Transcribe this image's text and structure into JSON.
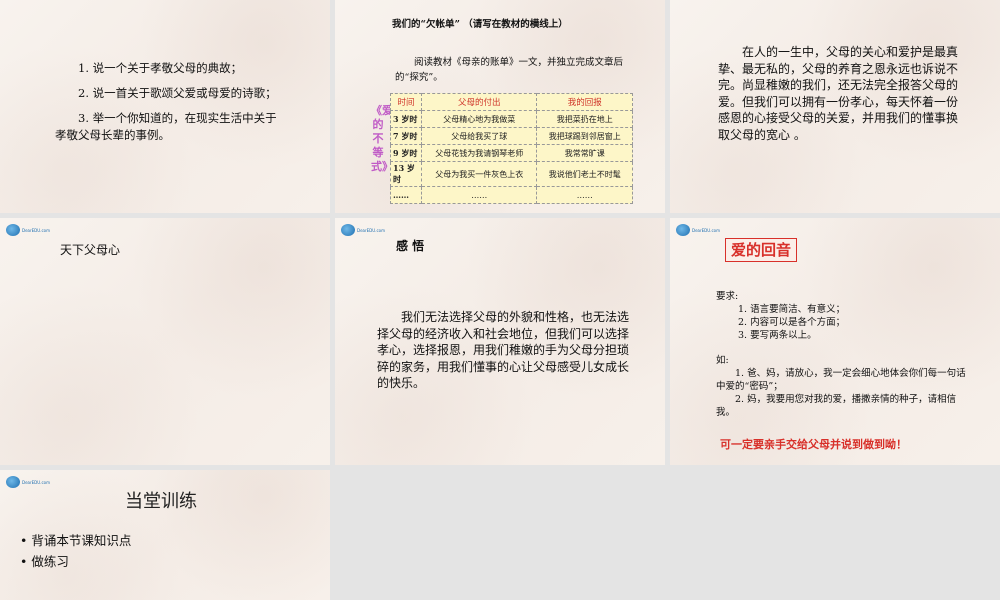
{
  "logo_text": "DearEDU.com",
  "slide1": {
    "items": [
      "1. 说一个关于孝敬父母的典故；",
      "2. 说一首关于歌颂父爱或母爱的诗歌；",
      "3. 举一个你知道的，在现实生活中关于孝敬父母长辈的事例。"
    ]
  },
  "slide2": {
    "heading": "我们的“欠帐单” （请写在教材的横线上）",
    "intro": "阅读教材《母亲的账单》一文，并独立完成文章后的“探究”。",
    "side_title": "《爱的不等式》",
    "table": {
      "headers": [
        "时间",
        "父母的付出",
        "我的回报"
      ],
      "rows": [
        [
          "3 岁时",
          "父母精心地为我做菜",
          "我把菜扔在地上"
        ],
        [
          "7 岁时",
          "父母给我买了球",
          "我把球踢到邻居窗上"
        ],
        [
          "9 岁时",
          "父母花钱为我请钢琴老师",
          "我常常旷课"
        ],
        [
          "13 岁时",
          "父母为我买一件灰色上衣",
          "我说他们老土不时髦"
        ],
        [
          "……",
          "……",
          "……"
        ]
      ]
    }
  },
  "slide3": {
    "body": "在人的一生中，父母的关心和爱护是最真挚、最无私的，父母的养育之恩永远也诉说不完。尚显稚嫩的我们，还无法完全报答父母的爱。但我们可以拥有一份孝心，每天怀着一份感恩的心接受父母的关爱，并用我们的懂事换取父母的宽心 。"
  },
  "slide4": {
    "title": "天下父母心"
  },
  "slide5": {
    "title": "感 悟",
    "body": "我们无法选择父母的外貌和性格，也无法选择父母的经济收入和社会地位，但我们可以选择孝心，选择报恩，用我们稚嫩的手为父母分担琐碎的家务，用我们懂事的心让父母感受儿女成长的快乐。"
  },
  "slide6": {
    "title": "爱的回音",
    "req_label": "要求:",
    "reqs": [
      "1. 语言要简洁、有意义；",
      "2. 内容可以是各个方面；",
      "3. 要写两条以上。"
    ],
    "ex_label": "如:",
    "examples": [
      "1. 爸、妈，请放心，我一定会细心地体会你们每一句话中爱的“密码”；",
      "2. 妈，我要用您对我的爱，播撒亲情的种子，请相信我。"
    ],
    "footer": "可一定要亲手交给父母并说到做到呦！"
  },
  "slide7": {
    "title": "当堂训练",
    "bullets": [
      "背诵本节课知识点",
      "做练习"
    ]
  },
  "colors": {
    "red": "#d8302a",
    "table_bg": "#fdf6c8",
    "accent_purple": "#c05bc6"
  }
}
